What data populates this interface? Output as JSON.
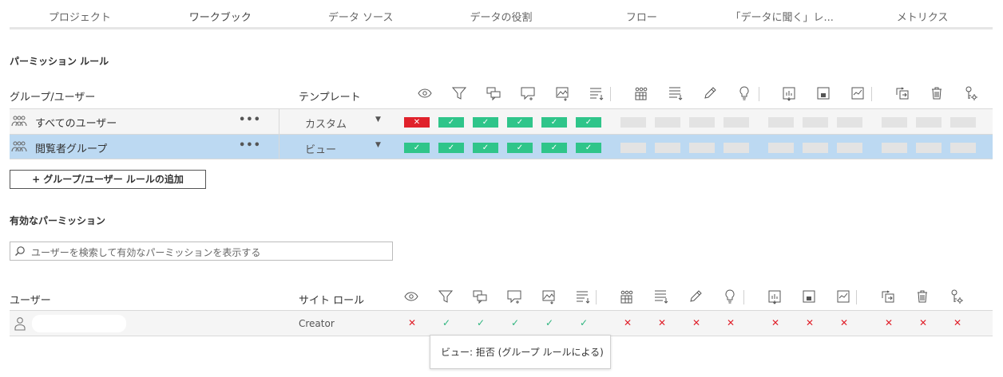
{
  "tabs": [
    {
      "label": "プロジェクト",
      "active": false
    },
    {
      "label": "ワークブック",
      "active": true
    },
    {
      "label": "データ ソース",
      "active": false
    },
    {
      "label": "データの役割",
      "active": false
    },
    {
      "label": "フロー",
      "active": false
    },
    {
      "label": "「データに聞く」レ...",
      "active": false
    },
    {
      "label": "メトリクス",
      "active": false
    }
  ],
  "rules_section": {
    "title": "パーミッション ルール",
    "col_group": "グループ/ユーザー",
    "col_template": "テンプレート"
  },
  "capability_icons": [
    "view-icon",
    "filter-icon",
    "comments-icon",
    "add-comment-icon",
    "export-image-icon",
    "summary-data-icon",
    "full-data-icon",
    "download-data-icon",
    "edit-icon",
    "explain-icon",
    "web-edit-icon",
    "save-icon",
    "download-workbook-icon",
    "move-icon",
    "delete-icon",
    "set-permissions-icon"
  ],
  "rules": [
    {
      "name": "すべてのユーザー",
      "more": "•••",
      "template": "カスタム",
      "caps": [
        "deny",
        "allow",
        "allow",
        "allow",
        "allow",
        "allow",
        "none",
        "none",
        "none",
        "none",
        "none",
        "none",
        "none",
        "none",
        "none",
        "none"
      ]
    },
    {
      "name": "閲覧者グループ",
      "more": "•••",
      "template": "ビュー",
      "caps": [
        "allow",
        "allow",
        "allow",
        "allow",
        "allow",
        "allow",
        "none",
        "none",
        "none",
        "none",
        "none",
        "none",
        "none",
        "none",
        "none",
        "none"
      ]
    }
  ],
  "add_rule_button": "+ グループ/ユーザー ルールの追加",
  "effective_section": {
    "title": "有効なパーミッション",
    "search_placeholder": "ユーザーを検索して有効なパーミッションを表示する",
    "col_user": "ユーザー",
    "col_site_role": "サイト ロール"
  },
  "effective_user": {
    "site_role": "Creator",
    "caps": [
      "deny",
      "allow",
      "allow",
      "allow",
      "allow",
      "allow",
      "deny",
      "deny",
      "deny",
      "deny",
      "deny",
      "deny",
      "deny",
      "deny",
      "deny",
      "deny"
    ]
  },
  "symbols": {
    "allow": "✓",
    "deny": "✕"
  },
  "tooltip": "ビュー: 拒否 (グループ ルールによる)",
  "colors": {
    "allow": "#2fc58a",
    "deny": "#e0212b",
    "selected_row": "#bcd9f2"
  }
}
